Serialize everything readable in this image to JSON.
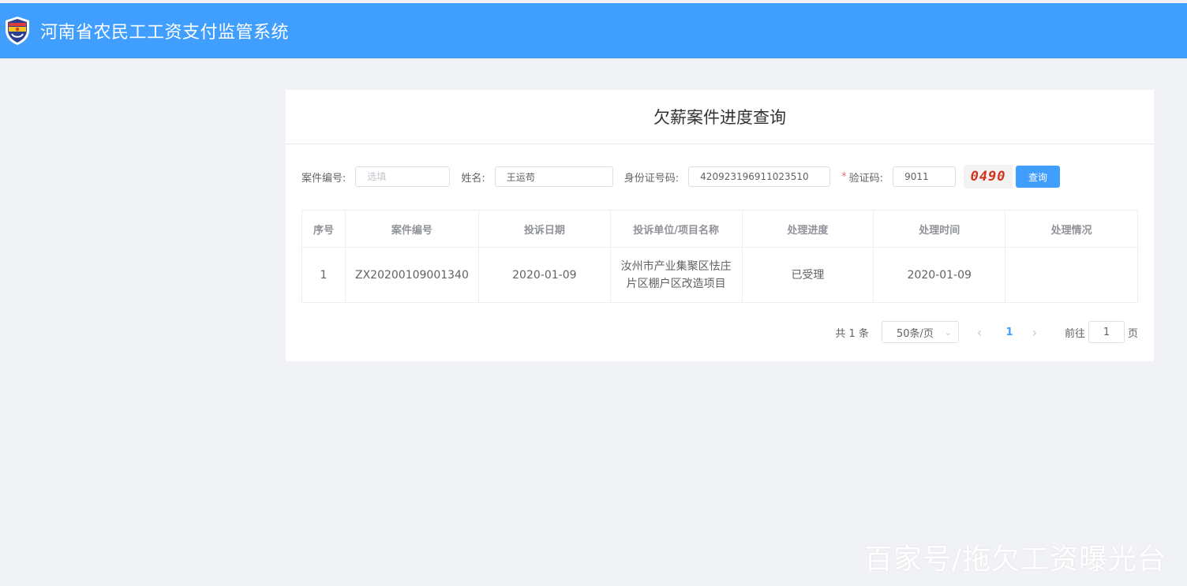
{
  "header": {
    "title": "河南省农民工工资支付监管系统",
    "logo_icon": "shield-badge-icon",
    "background": "#409eff"
  },
  "panel": {
    "title": "欠薪案件进度查询"
  },
  "form": {
    "case_no_label": "案件编号:",
    "case_no_placeholder": "选填",
    "case_no_value": "",
    "name_label": "姓名:",
    "name_value": "王运苟",
    "id_label": "身份证号码:",
    "id_value": "420923196911023510",
    "captcha_required_mark": "*",
    "captcha_label": "验证码:",
    "captcha_value": "9011",
    "captcha_image_text": "0490",
    "query_button": "查询"
  },
  "table": {
    "headers": [
      "序号",
      "案件编号",
      "投诉日期",
      "投诉单位/项目名称",
      "处理进度",
      "处理时间",
      "处理情况"
    ],
    "rows": [
      {
        "index": "1",
        "case_no": "ZX20200109001340",
        "complaint_date": "2020-01-09",
        "unit_project_line1": "汝州市产业集聚区怯庄",
        "unit_project_line2": "片区棚户区改造项目",
        "progress": "已受理",
        "process_time": "2020-01-09",
        "situation": ""
      }
    ]
  },
  "pagination": {
    "total_text": "共 1 条",
    "page_size": "50条/页",
    "current_page": "1",
    "goto_label": "前往",
    "goto_value": "1",
    "page_suffix": "页"
  },
  "watermark": "百家号/拖欠工资曝光台"
}
